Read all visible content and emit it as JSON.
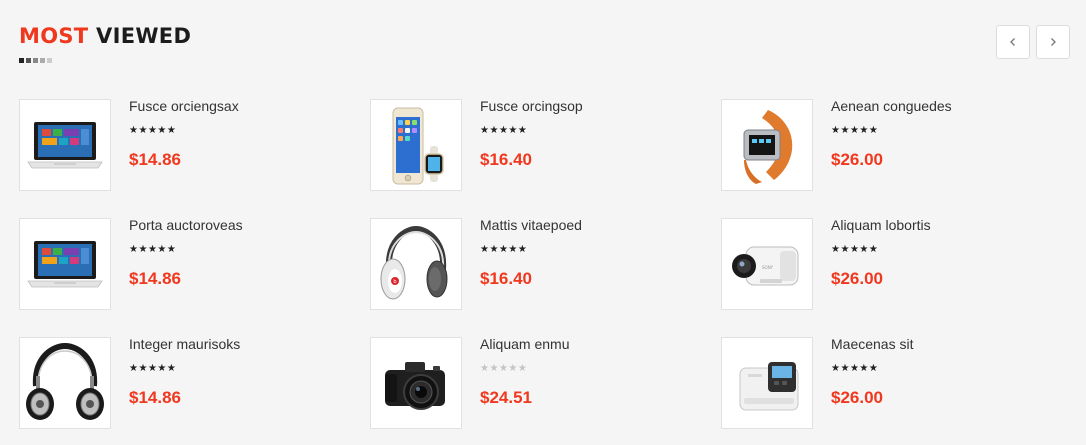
{
  "section": {
    "title_accent": "MOST",
    "title_rest": "VIEWED",
    "dot_colors": [
      "#222222",
      "#555555",
      "#888888",
      "#aaaaaa",
      "#cccccc"
    ]
  },
  "nav": {
    "prev_icon": "chevron-left-icon",
    "next_icon": "chevron-right-icon"
  },
  "colors": {
    "accent": "#f0381e",
    "star_filled": "#222222",
    "star_empty": "#c4c4c4"
  },
  "products": [
    {
      "name": "Fusce orciengsax",
      "price": "$14.86",
      "rating": 5,
      "image": "laptop"
    },
    {
      "name": "Fusce orcingsop",
      "price": "$16.40",
      "rating": 5,
      "image": "phone-watch"
    },
    {
      "name": "Aenean conguedes",
      "price": "$26.00",
      "rating": 5,
      "image": "smartwatch"
    },
    {
      "name": "Porta auctoroveas",
      "price": "$14.86",
      "rating": 5,
      "image": "laptop"
    },
    {
      "name": "Mattis vitaepoed",
      "price": "$16.40",
      "rating": 5,
      "image": "headphones-red"
    },
    {
      "name": "Aliquam lobortis",
      "price": "$26.00",
      "rating": 5,
      "image": "action-camera"
    },
    {
      "name": "Integer maurisoks",
      "price": "$14.86",
      "rating": 5,
      "image": "headphones-dj"
    },
    {
      "name": "Aliquam enmu",
      "price": "$24.51",
      "rating": 0,
      "image": "dslr-camera"
    },
    {
      "name": "Maecenas sit",
      "price": "$26.00",
      "rating": 5,
      "image": "printer"
    }
  ]
}
